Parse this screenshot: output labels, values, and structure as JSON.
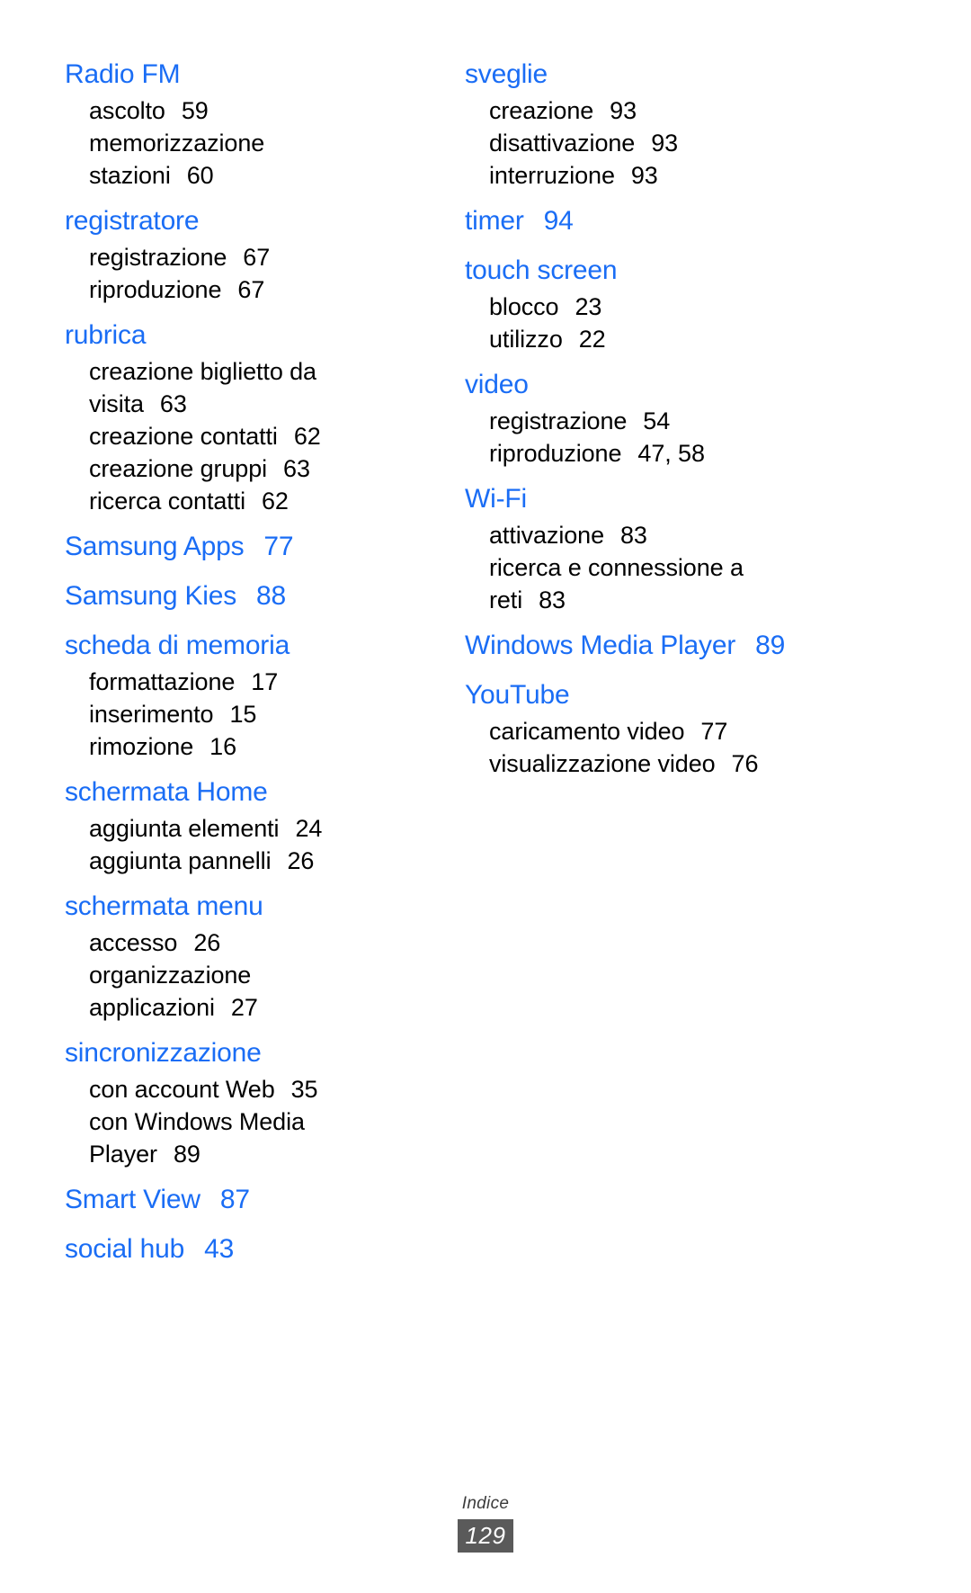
{
  "document": {
    "footer_label": "Indice",
    "page_number": "129",
    "heading_color": "#1a6df5",
    "entry_color": "#000000",
    "badge_color": "#5a5a5a"
  },
  "columns": [
    {
      "name": "left",
      "groups": [
        {
          "title": "Radio FM",
          "page": "",
          "entries": [
            {
              "label": "ascolto",
              "page": "59"
            },
            {
              "label": "memorizzazione",
              "page": ""
            },
            {
              "label": "stazioni",
              "page": "60"
            }
          ]
        },
        {
          "title": "registratore",
          "page": "",
          "entries": [
            {
              "label": "registrazione",
              "page": "67"
            },
            {
              "label": "riproduzione",
              "page": "67"
            }
          ]
        },
        {
          "title": "rubrica",
          "page": "",
          "entries": [
            {
              "label": "creazione biglietto da",
              "page": ""
            },
            {
              "label": "visita",
              "page": "63"
            },
            {
              "label": "creazione contatti",
              "page": "62"
            },
            {
              "label": "creazione gruppi",
              "page": "63"
            },
            {
              "label": "ricerca contatti",
              "page": "62"
            }
          ]
        },
        {
          "title": "Samsung Apps",
          "page": "77",
          "entries": []
        },
        {
          "title": "Samsung Kies",
          "page": "88",
          "entries": []
        },
        {
          "title": "scheda di memoria",
          "page": "",
          "entries": [
            {
              "label": "formattazione",
              "page": "17"
            },
            {
              "label": "inserimento",
              "page": "15"
            },
            {
              "label": "rimozione",
              "page": "16"
            }
          ]
        },
        {
          "title": "schermata Home",
          "page": "",
          "entries": [
            {
              "label": "aggiunta elementi",
              "page": "24"
            },
            {
              "label": "aggiunta pannelli",
              "page": "26"
            }
          ]
        },
        {
          "title": "schermata menu",
          "page": "",
          "entries": [
            {
              "label": "accesso",
              "page": "26"
            },
            {
              "label": "organizzazione",
              "page": ""
            },
            {
              "label": "applicazioni",
              "page": "27"
            }
          ]
        },
        {
          "title": "sincronizzazione",
          "page": "",
          "entries": [
            {
              "label": "con account Web",
              "page": "35"
            },
            {
              "label": "con Windows Media",
              "page": ""
            },
            {
              "label": "Player",
              "page": "89"
            }
          ]
        },
        {
          "title": "Smart View",
          "page": "87",
          "entries": []
        },
        {
          "title": "social hub",
          "page": "43",
          "entries": []
        }
      ]
    },
    {
      "name": "right",
      "groups": [
        {
          "title": "sveglie",
          "page": "",
          "entries": [
            {
              "label": "creazione",
              "page": "93"
            },
            {
              "label": "disattivazione",
              "page": "93"
            },
            {
              "label": "interruzione",
              "page": "93"
            }
          ]
        },
        {
          "title": "timer",
          "page": "94",
          "entries": []
        },
        {
          "title": "touch screen",
          "page": "",
          "entries": [
            {
              "label": "blocco",
              "page": "23"
            },
            {
              "label": "utilizzo",
              "page": "22"
            }
          ]
        },
        {
          "title": "video",
          "page": "",
          "entries": [
            {
              "label": "registrazione",
              "page": "54"
            },
            {
              "label": "riproduzione",
              "page": "47, 58"
            }
          ]
        },
        {
          "title": "Wi-Fi",
          "page": "",
          "entries": [
            {
              "label": "attivazione",
              "page": "83"
            },
            {
              "label": "ricerca e connessione a",
              "page": ""
            },
            {
              "label": "reti",
              "page": "83"
            }
          ]
        },
        {
          "title": "Windows Media Player",
          "page": "89",
          "entries": []
        },
        {
          "title": "YouTube",
          "page": "",
          "entries": [
            {
              "label": "caricamento video",
              "page": "77"
            },
            {
              "label": "visualizzazione video",
              "page": "76"
            }
          ]
        }
      ]
    }
  ]
}
